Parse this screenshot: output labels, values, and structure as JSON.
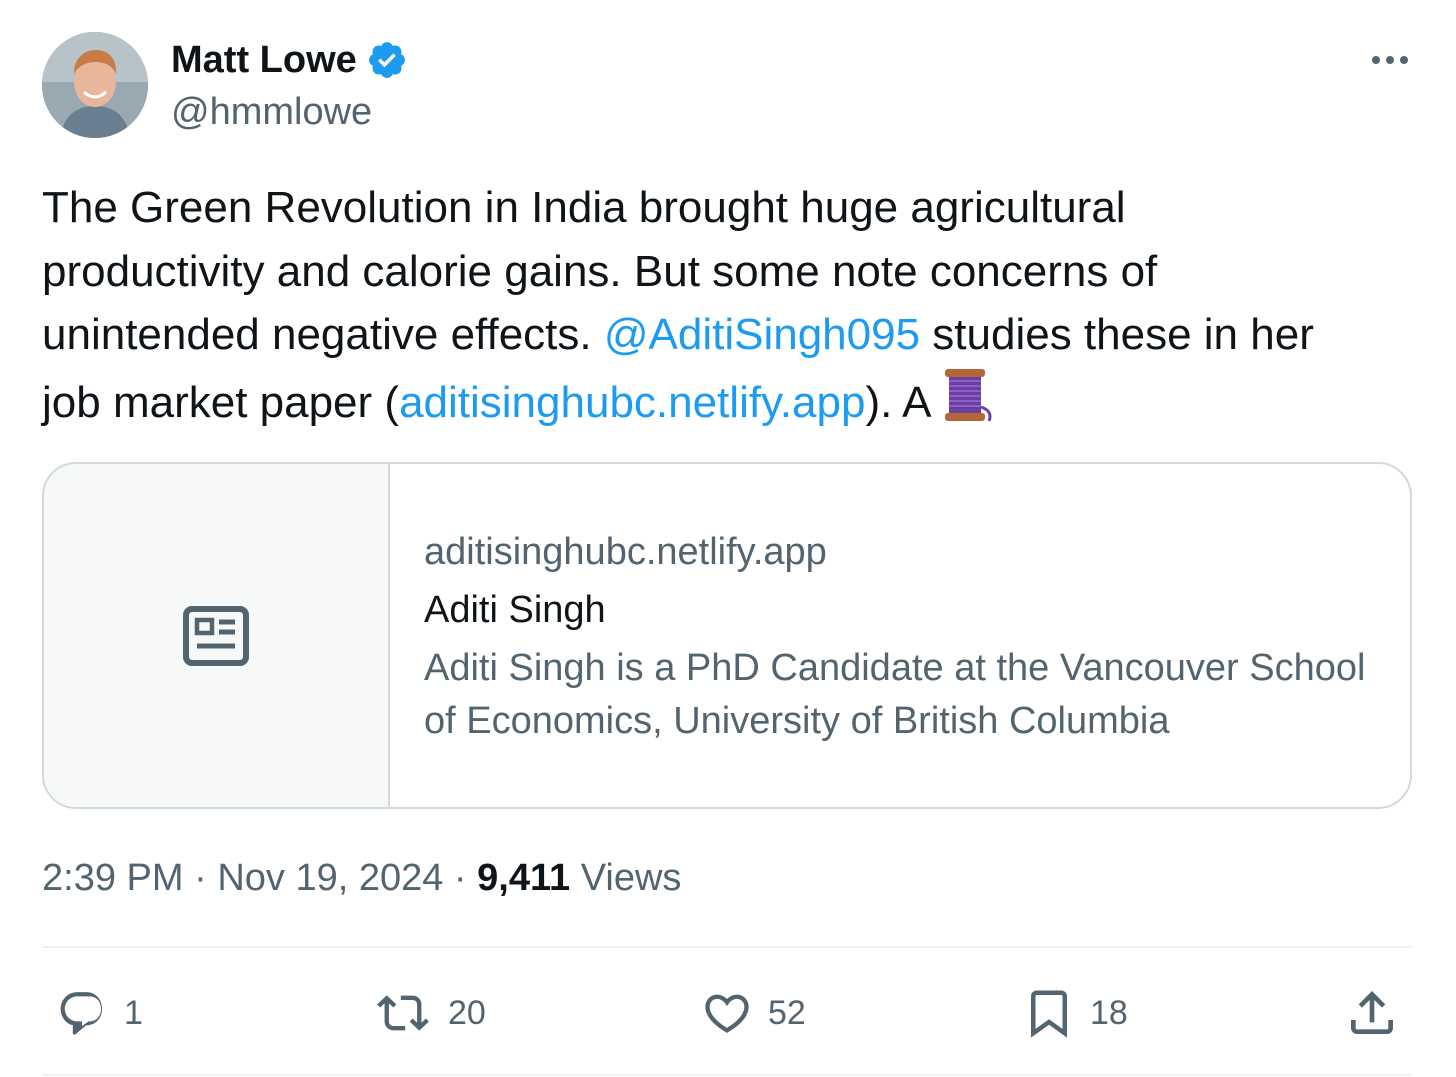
{
  "author": {
    "name": "Matt Lowe",
    "handle": "@hmmlowe",
    "verified": true
  },
  "tweet": {
    "line1": "The Green Revolution in India brought huge agricultural",
    "line2": "productivity and calorie gains. But some note concerns of",
    "line3_before": "unintended negative effects. ",
    "mention": "@AditiSingh095",
    "line3_after": " studies these in her",
    "line4_before": "job market paper (",
    "url": "aditisinghubc.netlify.app",
    "line4_after": "). A",
    "emoji": "spool-of-thread"
  },
  "card": {
    "domain": "aditisinghubc.netlify.app",
    "title": "Aditi Singh",
    "description": "Aditi Singh is a PhD Candidate at the Vancouver School of Economics, University of British Columbia"
  },
  "meta": {
    "time": "2:39 PM",
    "separator": " · ",
    "date": "Nov 19, 2024",
    "views_count": "9,411",
    "views_label": " Views"
  },
  "actions": {
    "replies": "1",
    "retweets": "20",
    "likes": "52",
    "bookmarks": "18"
  },
  "colors": {
    "link": "#1d9bf0",
    "muted": "#536471",
    "text": "#0f1419",
    "border": "#cfd9de"
  }
}
